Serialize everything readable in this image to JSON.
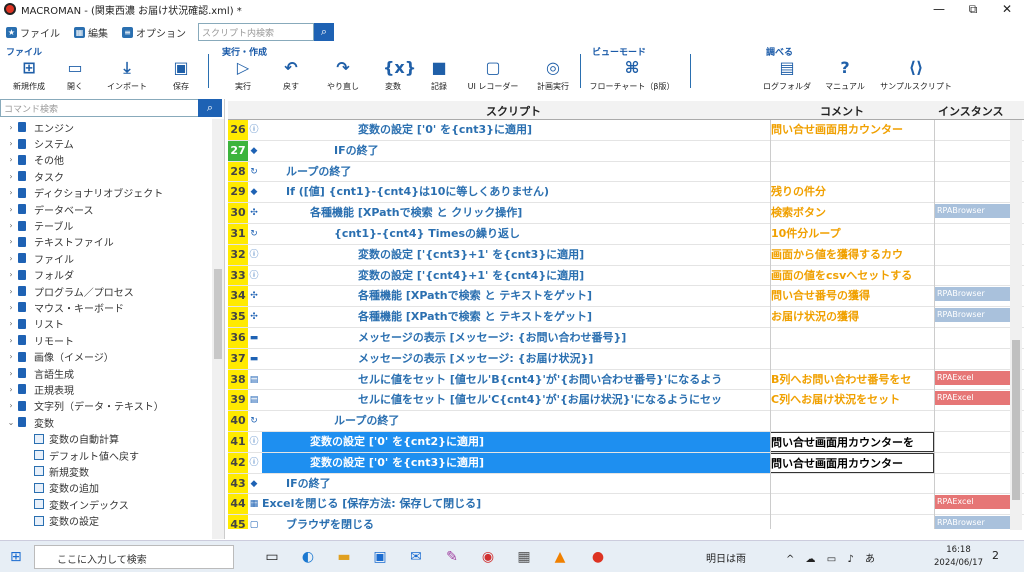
{
  "window": {
    "title": "MACROMAN - (関東西濃 お届け状況確認.xml) *",
    "min": "—",
    "max": "⧉",
    "close": "✕"
  },
  "menu": {
    "file": "ファイル",
    "edit": "編集",
    "options": "オプション",
    "script_search_placeholder": "スクリプト内検索"
  },
  "ribbon": {
    "groups": {
      "file": "ファイル",
      "run": "実行・作成",
      "view": "ビューモード",
      "inspect": "調べる"
    },
    "tools": {
      "new": "新規作成",
      "open": "開く",
      "import": "インポート",
      "save": "保存",
      "run": "実行",
      "undo": "戻す",
      "redo": "やり直し",
      "variables": "変数",
      "record": "記録",
      "ui_recorder": "UI レコーダー",
      "plan_run": "計画実行",
      "flowchart": "フローチャート（β版）",
      "log_folder": "ログフォルダ",
      "manual": "マニュアル",
      "samples": "サンプルスクリプト"
    }
  },
  "sidebar": {
    "search_placeholder": "コマンド検索",
    "items": [
      "エンジン",
      "システム",
      "その他",
      "タスク",
      "ディクショナリオブジェクト",
      "データベース",
      "テーブル",
      "テキストファイル",
      "ファイル",
      "フォルダ",
      "プログラム／プロセス",
      "マウス・キーボード",
      "リスト",
      "リモート",
      "画像（イメージ）",
      "言語生成",
      "正規表現",
      "文字列（データ・テキスト）",
      "変数"
    ],
    "children": [
      "変数の自動計算",
      "デフォルト値へ戻す",
      "新規変数",
      "変数の追加",
      "変数インデックス",
      "変数の設定"
    ]
  },
  "grid": {
    "headers": {
      "script": "スクリプト",
      "comment": "コメント",
      "instance": "インスタンス"
    },
    "rows": [
      {
        "n": "26",
        "ico": "ⓘ",
        "text": "変数の設定 ['0' を{cnt3}に適用]",
        "comment": "問い合せ画面用カウンター",
        "inst": "",
        "cls": ""
      },
      {
        "n": "27",
        "ico": "◆",
        "text": "IFの終了",
        "comment": "",
        "inst": "",
        "cls": ""
      },
      {
        "n": "28",
        "ico": "↻",
        "text": "ループの終了",
        "comment": "",
        "inst": "",
        "cls": ""
      },
      {
        "n": "29",
        "ico": "◆",
        "text": "If ([値] {cnt1}-{cnt4}は10に等しくありません)",
        "comment": "残りの件分",
        "inst": "",
        "cls": ""
      },
      {
        "n": "30",
        "ico": "✣",
        "text": "各種機能 [XPathで検索 と クリック操作]",
        "comment": "検索ボタン",
        "inst": "RPABrowser",
        "cls": "b"
      },
      {
        "n": "31",
        "ico": "↻",
        "text": "{cnt1}-{cnt4} Timesの繰り返し",
        "comment": "10件分ループ",
        "inst": "",
        "cls": ""
      },
      {
        "n": "32",
        "ico": "ⓘ",
        "text": "変数の設定 ['{cnt3}+1' を{cnt3}に適用]",
        "comment": "画面から値を獲得するカウ",
        "inst": "",
        "cls": ""
      },
      {
        "n": "33",
        "ico": "ⓘ",
        "text": "変数の設定 ['{cnt4}+1' を{cnt4}に適用]",
        "comment": "画面の値をcsvへセットする",
        "inst": "",
        "cls": ""
      },
      {
        "n": "34",
        "ico": "✣",
        "text": "各種機能 [XPathで検索 と テキストをゲット]",
        "comment": "問い合せ番号の獲得",
        "inst": "RPABrowser",
        "cls": "b"
      },
      {
        "n": "35",
        "ico": "✣",
        "text": "各種機能 [XPathで検索 と テキストをゲット]",
        "comment": "お届け状況の獲得",
        "inst": "RPABrowser",
        "cls": "b"
      },
      {
        "n": "36",
        "ico": "▬",
        "text": "メッセージの表示 [メッセージ: {お問い合わせ番号}]",
        "comment": "",
        "inst": "",
        "cls": ""
      },
      {
        "n": "37",
        "ico": "▬",
        "text": "メッセージの表示 [メッセージ: {お届け状況}]",
        "comment": "",
        "inst": "",
        "cls": ""
      },
      {
        "n": "38",
        "ico": "▤",
        "text": "セルに値をセット [値セル'B{cnt4}'が'{お問い合わせ番号}'になるよう",
        "comment": "B列へお問い合わせ番号をセ",
        "inst": "RPAExcel",
        "cls": "r"
      },
      {
        "n": "39",
        "ico": "▤",
        "text": "セルに値をセット [値セル'C{cnt4}'が'{お届け状況}'になるようにセッ",
        "comment": "C列へお届け状況をセット",
        "inst": "RPAExcel",
        "cls": "r"
      },
      {
        "n": "40",
        "ico": "↻",
        "text": "ループの終了",
        "comment": "",
        "inst": "",
        "cls": ""
      },
      {
        "n": "41",
        "ico": "ⓘ",
        "text": "変数の設定 ['0' を{cnt2}に適用]",
        "comment": "問い合せ画面用カウンターを",
        "inst": "",
        "cls": ""
      },
      {
        "n": "42",
        "ico": "ⓘ",
        "text": "変数の設定 ['0' を{cnt3}に適用]",
        "comment": "問い合せ画面用カウンター",
        "inst": "",
        "cls": ""
      },
      {
        "n": "43",
        "ico": "◆",
        "text": "IFの終了",
        "comment": "",
        "inst": "",
        "cls": ""
      },
      {
        "n": "44",
        "ico": "▦",
        "text": "Excelを閉じる [保存方法: 保存して閉じる]",
        "comment": "",
        "inst": "RPAExcel",
        "cls": "r"
      },
      {
        "n": "45",
        "ico": "▢",
        "text": "ブラウザを閉じる",
        "comment": "",
        "inst": "RPABrowser",
        "cls": "b"
      }
    ]
  },
  "taskbar": {
    "search": "ここに入力して検索",
    "weather": "明日は雨",
    "ime": "あ",
    "time": "16:18",
    "date": "2024/06/17",
    "notif": "2"
  }
}
